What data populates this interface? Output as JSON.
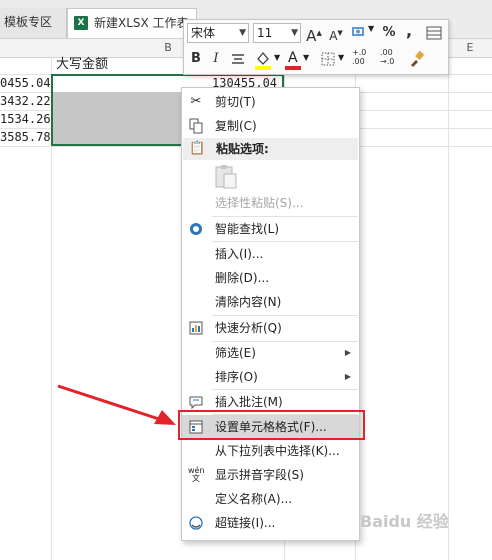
{
  "tabs": {
    "template": "模板专区",
    "xlsx": "新建XLSX 工作表",
    "xlsx_icon": "X"
  },
  "columns": {
    "b": "B",
    "e": "E"
  },
  "sheet": {
    "b1": "大写金额",
    "c1": "130455.04",
    "a_values": [
      "0455.04",
      "3432.22",
      "1534.26",
      "3585.78"
    ]
  },
  "mini_toolbar": {
    "font": "宋体",
    "size": "11",
    "grow": "A",
    "shrink": "A",
    "percent": "%",
    "comma": ",",
    "bold": "B",
    "italic": "I",
    "font_color": "A",
    "inc_decimal": "+.0\n.00",
    "dec_decimal": ".00\n→.0"
  },
  "menu": {
    "cut": "剪切(T)",
    "copy": "复制(C)",
    "paste_options": "粘贴选项:",
    "paste_special": "选择性粘贴(S)...",
    "smart_lookup": "智能查找(L)",
    "insert": "插入(I)...",
    "delete": "删除(D)...",
    "clear": "清除内容(N)",
    "quick_analysis": "快速分析(Q)",
    "filter": "筛选(E)",
    "sort": "排序(O)",
    "insert_comment": "插入批注(M)",
    "format_cells": "设置单元格格式(F)...",
    "pick_list": "从下拉列表中选择(K)...",
    "phonetic": "显示拼音字段(S)",
    "define_name": "定义名称(A)...",
    "hyperlink": "超链接(I)..."
  },
  "watermark": "Baidu 经验",
  "colors": {
    "excel_green": "#217346",
    "annotation_red": "#e0242a"
  }
}
